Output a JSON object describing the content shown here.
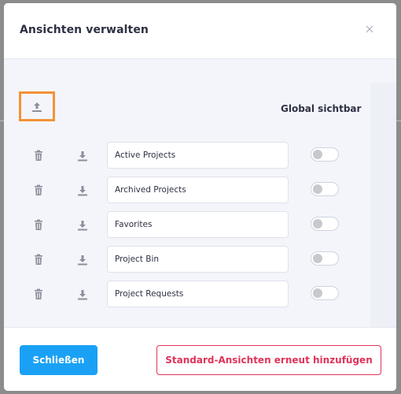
{
  "dialog": {
    "title": "Ansichten verwalten",
    "close_icon": "close-icon"
  },
  "toolbar": {
    "upload_icon": "upload-icon",
    "upload_highlight_color": "#f39237",
    "global_visible_label": "Global sichtbar"
  },
  "views": [
    {
      "name": "Active Projects",
      "global_visible": false
    },
    {
      "name": "Archived Projects",
      "global_visible": false
    },
    {
      "name": "Favorites",
      "global_visible": false
    },
    {
      "name": "Project Bin",
      "global_visible": false
    },
    {
      "name": "Project Requests",
      "global_visible": false
    }
  ],
  "row_icons": {
    "delete": "trash-icon",
    "download": "download-icon"
  },
  "footer": {
    "close_label": "Schließen",
    "close_color": "#1aa1f5",
    "reset_label": "Standard-Ansichten erneut hinzufügen",
    "reset_color": "#e0335a"
  }
}
